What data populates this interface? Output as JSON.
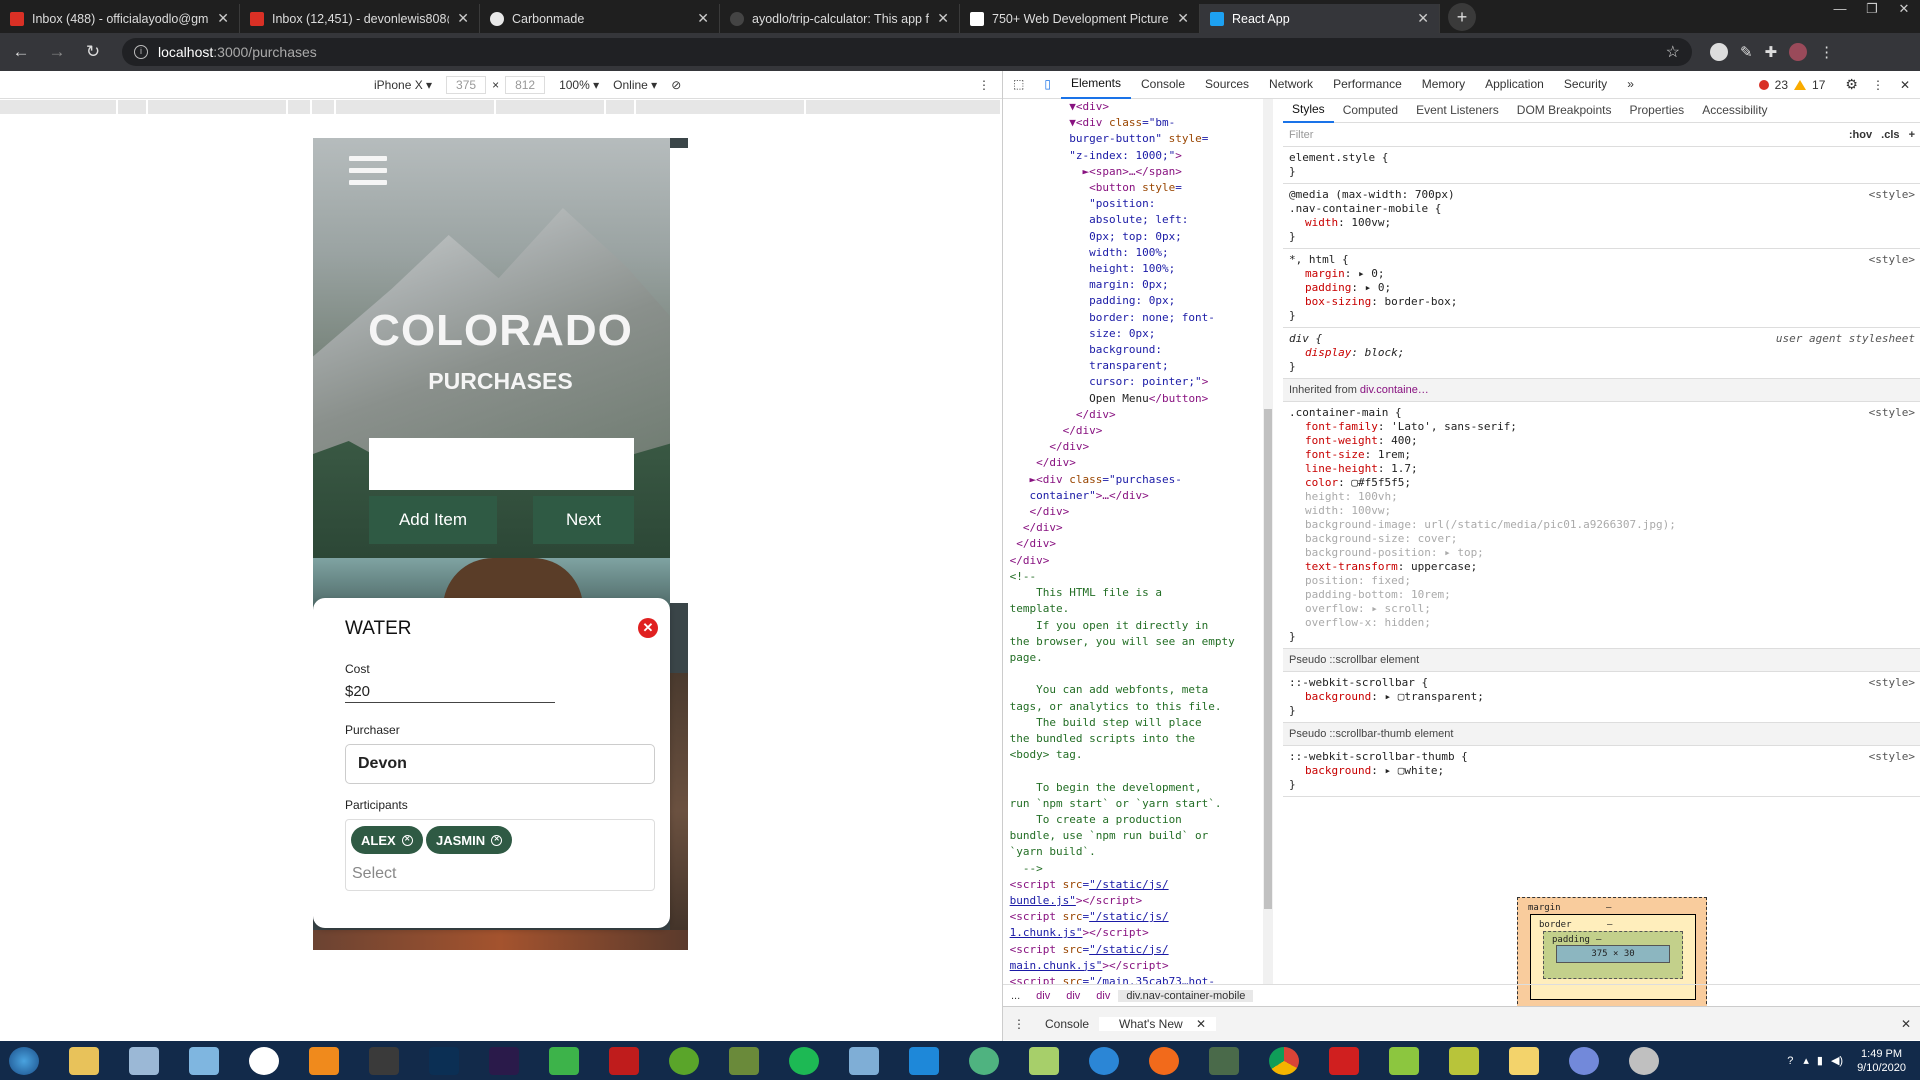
{
  "browser": {
    "tabs": [
      {
        "title": "Inbox (488) - officialayodlo@gm",
        "icon": "gmail-icon",
        "color": "#d93025"
      },
      {
        "title": "Inbox (12,451) - devonlewis808@",
        "icon": "gmail-icon",
        "color": "#d93025"
      },
      {
        "title": "Carbonmade",
        "icon": "carbonmade-icon",
        "color": "#e8e8e8"
      },
      {
        "title": "ayodlo/trip-calculator: This app f",
        "icon": "github-icon",
        "color": "#ffffff"
      },
      {
        "title": "750+ Web Development Picture",
        "icon": "unsplash-icon",
        "color": "#111111"
      },
      {
        "title": "React App",
        "icon": "react-icon",
        "color": "#1da1f2"
      }
    ],
    "active_tab": 5,
    "url": "localhost:3000/purchases",
    "url_host": "localhost",
    "url_path": ":3000/purchases"
  },
  "device_toolbar": {
    "device": "iPhone X",
    "width": "375",
    "height": "812",
    "zoom": "100%",
    "throttle": "Online"
  },
  "app": {
    "city": "COLORADO",
    "page": "PURCHASES",
    "add_item": "Add Item",
    "next": "Next",
    "card": {
      "title": "WATER",
      "cost_label": "Cost",
      "cost_value": "$20",
      "purchaser_label": "Purchaser",
      "purchaser_value": "Devon",
      "participants_label": "Participants",
      "participants": [
        "ALEX",
        "JASMIN"
      ],
      "select_placeholder": "Select"
    }
  },
  "devtools": {
    "tabs": [
      "Elements",
      "Console",
      "Sources",
      "Network",
      "Performance",
      "Memory",
      "Application",
      "Security"
    ],
    "more": "»",
    "errors": "23",
    "warnings": "17",
    "styles_tabs": [
      "Styles",
      "Computed",
      "Event Listeners",
      "DOM Breakpoints",
      "Properties",
      "Accessibility"
    ],
    "filter_placeholder": "Filter",
    "hov": ":hov",
    "cls": ".cls",
    "breadcrumbs": [
      "...",
      "div",
      "div",
      "div",
      "div.nav-container-mobile"
    ],
    "drawer_tabs": [
      "Console",
      "What's New"
    ],
    "inherited_from": "Inherited from ",
    "inherited_link": "div.containe…",
    "pseudo1": "Pseudo ::scrollbar element",
    "pseudo2": "Pseudo ::scrollbar-thumb element",
    "user_agent": "user agent stylesheet",
    "style_src": "<style>",
    "box": {
      "margin": "margin",
      "border": "border",
      "padding": "padding",
      "content": "375 × 30",
      "dash": "–"
    }
  },
  "taskbar": {
    "time": "1:49 PM",
    "date": "9/10/2020"
  }
}
